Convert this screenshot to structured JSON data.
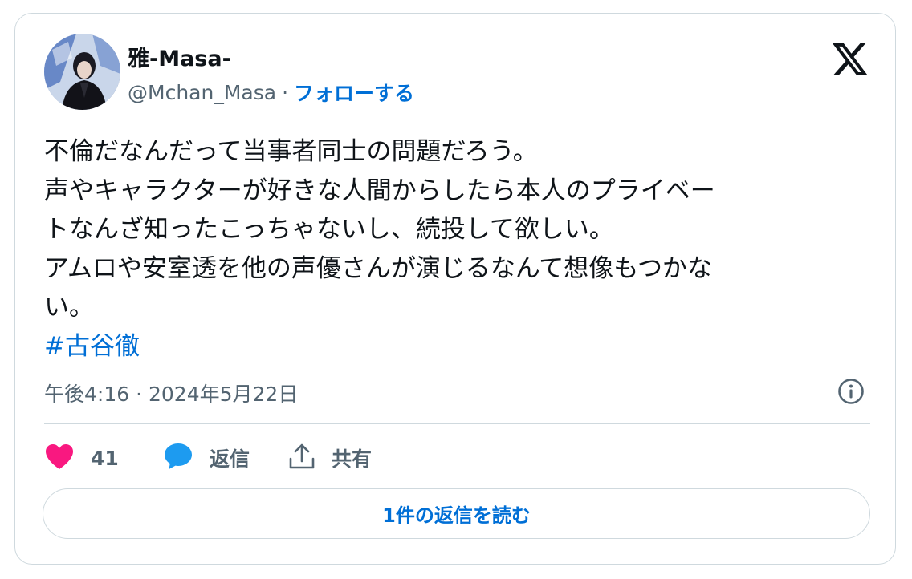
{
  "author": {
    "display_name": "雅-Masa-",
    "handle": "@Mchan_Masa",
    "separator": "·",
    "follow_label": "フォローする"
  },
  "tweet": {
    "lines": [
      "不倫だなんだって当事者同士の問題だろう。",
      "声やキャラクターが好きな人間からしたら本人のプライベー",
      "トなんざ知ったこっちゃないし、続投して欲しい。",
      "アムロや安室透を他の声優さんが演じるなんて想像もつかな",
      "い。"
    ],
    "hashtag": "#古谷徹",
    "timestamp": "午後4:16 · 2024年5月22日"
  },
  "actions": {
    "like_count": "41",
    "reply_label": "返信",
    "share_label": "共有"
  },
  "read_replies_label": "1件の返信を読む",
  "colors": {
    "link": "#006fd6",
    "like": "#f91880",
    "reply": "#1d9bf0",
    "muted": "#536471",
    "border": "#cfd9de"
  },
  "icons": {
    "logo": "x-logo-icon",
    "info": "info-icon",
    "like": "heart-icon",
    "reply": "speech-bubble-icon",
    "share": "share-upload-icon"
  }
}
